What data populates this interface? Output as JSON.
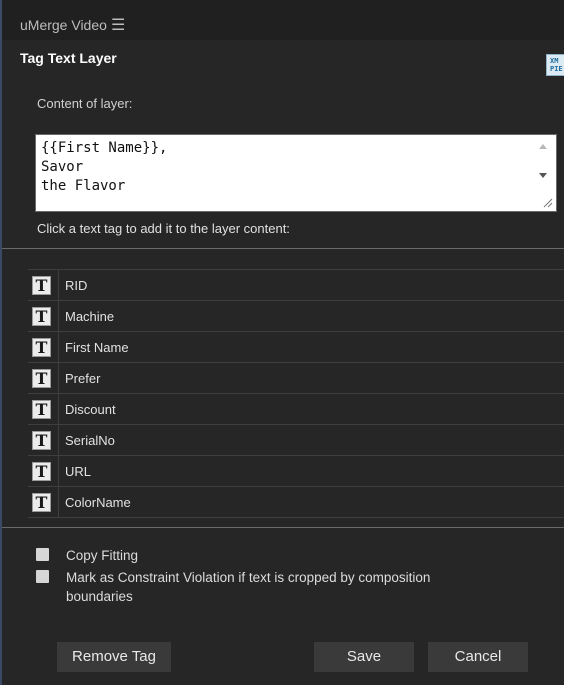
{
  "app": {
    "title": "uMerge Video",
    "menu_icon": "☰"
  },
  "panel": {
    "title": "Tag Text Layer",
    "badge_text": "XM\nPIE"
  },
  "content": {
    "label": "Content of layer:",
    "value": "{{First Name}},\nSavor\nthe Flavor"
  },
  "hint": "Click a text tag to add it to the layer content:",
  "tags": [
    {
      "icon": "T",
      "label": "RID"
    },
    {
      "icon": "T",
      "label": "Machine"
    },
    {
      "icon": "T",
      "label": "First Name"
    },
    {
      "icon": "T",
      "label": "Prefer"
    },
    {
      "icon": "T",
      "label": "Discount"
    },
    {
      "icon": "T",
      "label": "SerialNo"
    },
    {
      "icon": "T",
      "label": "URL"
    },
    {
      "icon": "T",
      "label": "ColorName"
    }
  ],
  "options": {
    "copy_fitting": {
      "label": "Copy Fitting",
      "checked": false
    },
    "constraint_violation": {
      "line1": "Mark as Constraint Violation if text is cropped by composition",
      "line2": "boundaries",
      "checked": false
    }
  },
  "buttons": {
    "remove_tag": "Remove Tag",
    "save": "Save",
    "cancel": "Cancel"
  }
}
